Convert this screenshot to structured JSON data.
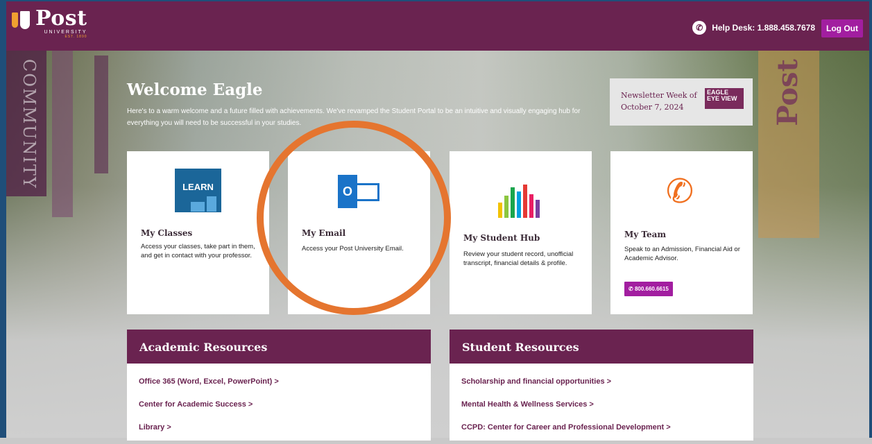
{
  "header": {
    "logo_name": "Post",
    "logo_sub": "UNIVERSITY",
    "logo_est": "EST. 1890",
    "helpdesk_label": "Help Desk: 1.888.458.7678",
    "logout_label": "Log Out"
  },
  "hero": {
    "left_banner_text": "COMMUNITY",
    "right_banner_text": "Post",
    "title": "Welcome Eagle",
    "text": "Here's to a warm welcome and a future filled with achievements. We've revamped the Student Portal to be an intuitive and visually engaging hub for everything you will need to be successful in your studies."
  },
  "newsletter": {
    "text": "Newsletter Week of October 7, 2024",
    "image_text": "EAGLE EYE VIEW"
  },
  "cards": [
    {
      "title": "My Classes",
      "desc": "Access your classes, take part in them, and get in contact with your professor.",
      "icon": "learn-icon",
      "icon_text": "LEARN"
    },
    {
      "title": "My Email",
      "desc": "Access your Post University Email.",
      "icon": "outlook-icon",
      "icon_text": "O"
    },
    {
      "title": "My Student Hub",
      "desc": "Review your student record, unofficial transcript, financial details & profile.",
      "icon": "bar-chart-icon"
    },
    {
      "title": "My Team",
      "desc": "Speak to an Admission, Financial Aid or Academic Advisor.",
      "icon": "phone-icon",
      "button": "800.660.6615"
    }
  ],
  "academic": {
    "heading": "Academic Resources",
    "links": [
      "Office 365 (Word, Excel, PowerPoint) >",
      "Center for Academic Success >",
      "Library >"
    ]
  },
  "student": {
    "heading": "Student Resources",
    "links": [
      "Scholarship and financial opportunities >",
      "Mental Health & Wellness Services >",
      "CCPD: Center for Career and Professional Development >"
    ]
  },
  "colors": {
    "primary": "#6a2350",
    "button": "#a21ea0",
    "highlight": "#e5752f"
  }
}
